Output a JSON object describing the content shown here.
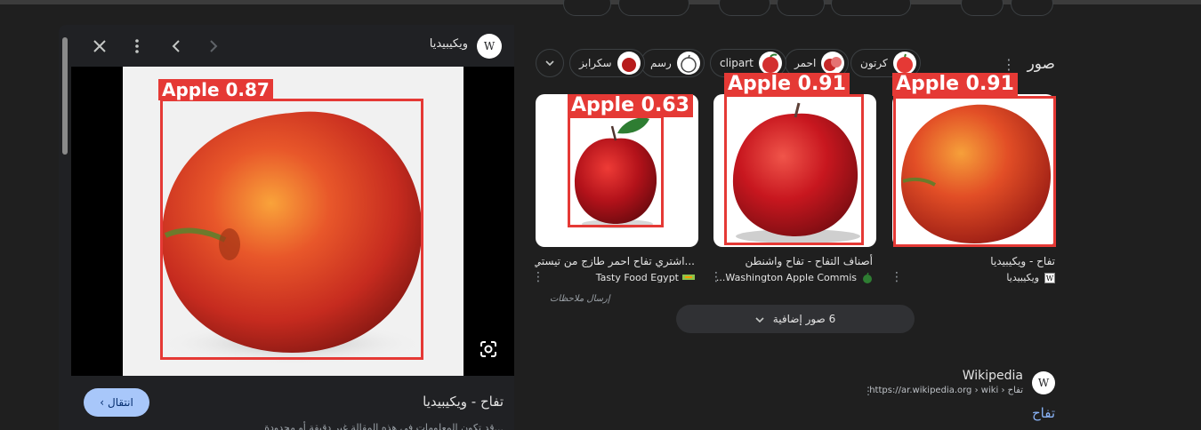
{
  "viewer": {
    "site_name": "ويكيبيديا",
    "site_initial": "W",
    "title": "تفاح - ويكيبيديا",
    "go_label": "انتقال",
    "snippet": "...قد تكون المعلومات في هذه المقالة غير دقيقة أو محدودة",
    "detection": {
      "label": "Apple 0.87"
    }
  },
  "images_section": {
    "title": "صور",
    "filters": [
      {
        "label": "كرتون"
      },
      {
        "label": "احمر"
      },
      {
        "label": "clipart"
      },
      {
        "label": "رسم"
      },
      {
        "label": "سكرابز"
      }
    ]
  },
  "results": [
    {
      "title": "تفاح - ويكيبيديا",
      "source": "ويكيبيديا",
      "detection": "Apple 0.91"
    },
    {
      "title": "أصناف التفاح - تفاح واشنطن",
      "source": "Washington Apple Commis...",
      "detection": "Apple 0.91"
    },
    {
      "title": "...اشتري تفاح احمر طازج من تيستي فو",
      "source": "Tasty Food Egypt",
      "detection": "Apple 0.63"
    }
  ],
  "feedback": "إرسال ملاحظات",
  "more_images": "6 صور إضافية",
  "wiki_result": {
    "name": "Wikipedia",
    "url": "https://ar.wikipedia.org › wiki › تفاح",
    "link": "تفاح"
  },
  "colors": {
    "background": "#1f1f1f",
    "detection": "#e53935",
    "link": "#8ab4f8",
    "go_button": "#a8c7fa"
  }
}
